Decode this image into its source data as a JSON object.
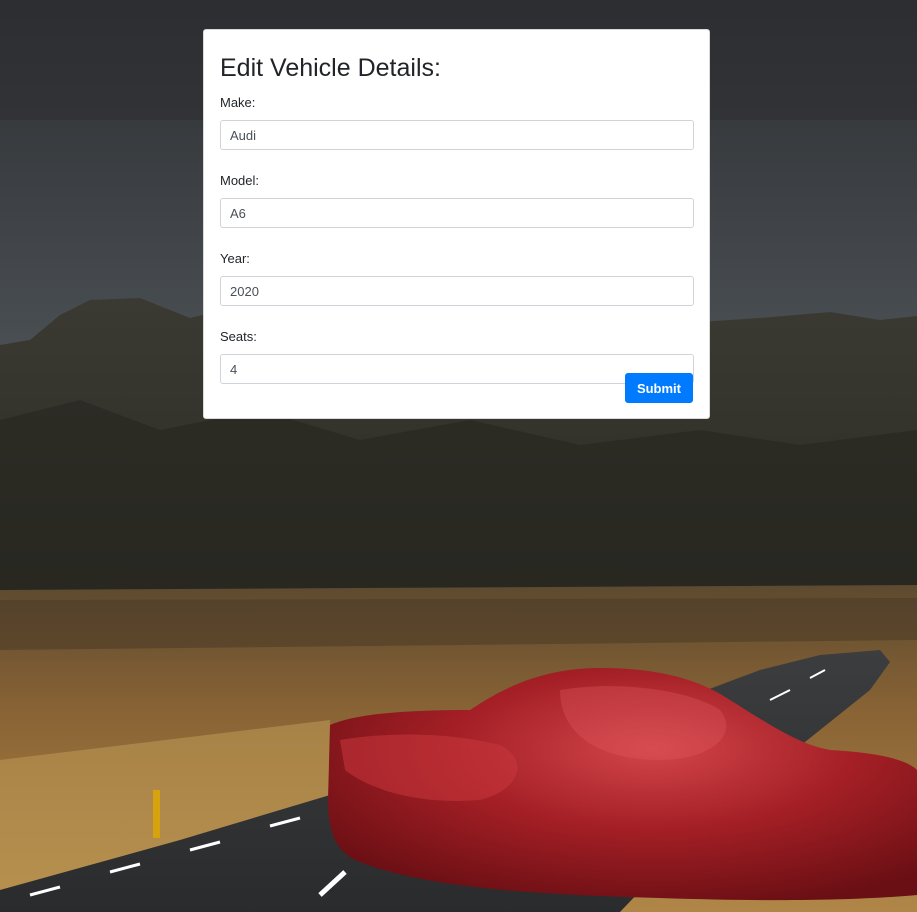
{
  "form": {
    "title": "Edit Vehicle Details:",
    "fields": [
      {
        "label": "Make:",
        "value": "Audi"
      },
      {
        "label": "Model:",
        "value": "A6"
      },
      {
        "label": "Year:",
        "value": "2020"
      },
      {
        "label": "Seats:",
        "value": "4"
      }
    ],
    "submit_label": "Submit"
  },
  "colors": {
    "accent": "#007bff",
    "car": "#9e1c22"
  }
}
